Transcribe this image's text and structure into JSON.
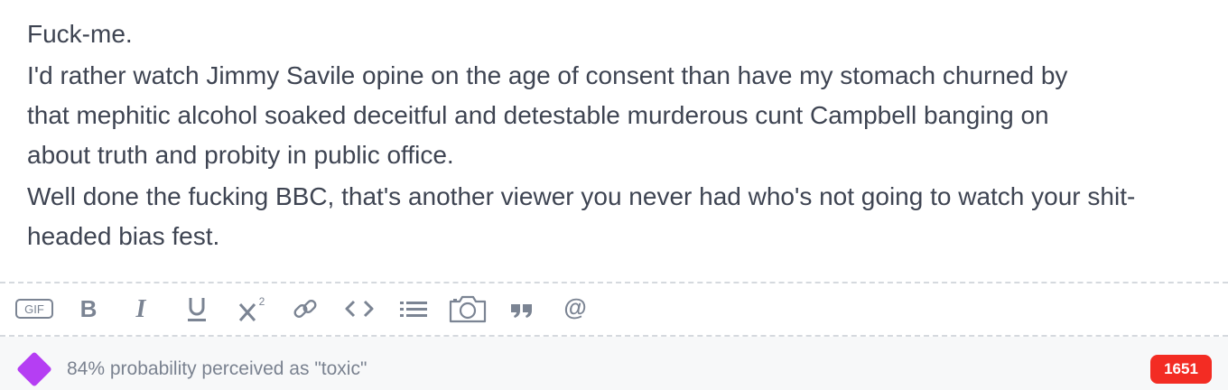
{
  "editor": {
    "paragraphs": [
      "Fuck-me.",
      "I'd rather watch Jimmy Savile opine on the age of consent than have my stomach churned by that mephitic alcohol soaked deceitful and detestable murderous cunt Campbell banging on about truth and probity in public office.",
      "Well done the fucking BBC, that's another viewer you never had who's not going to watch your shit-headed bias fest."
    ]
  },
  "toolbar": {
    "gif_label": "GIF",
    "icons": [
      "gif-icon",
      "bold-icon",
      "italic-icon",
      "underline-icon",
      "superscript-icon",
      "link-icon",
      "code-icon",
      "list-icon",
      "camera-icon",
      "quote-icon",
      "mention-icon"
    ]
  },
  "footer": {
    "toxicity_text": "84% probability perceived as \"toxic\"",
    "indicator_color": "#b53ef3",
    "char_count": "1651",
    "count_badge_color": "#f32c23"
  }
}
